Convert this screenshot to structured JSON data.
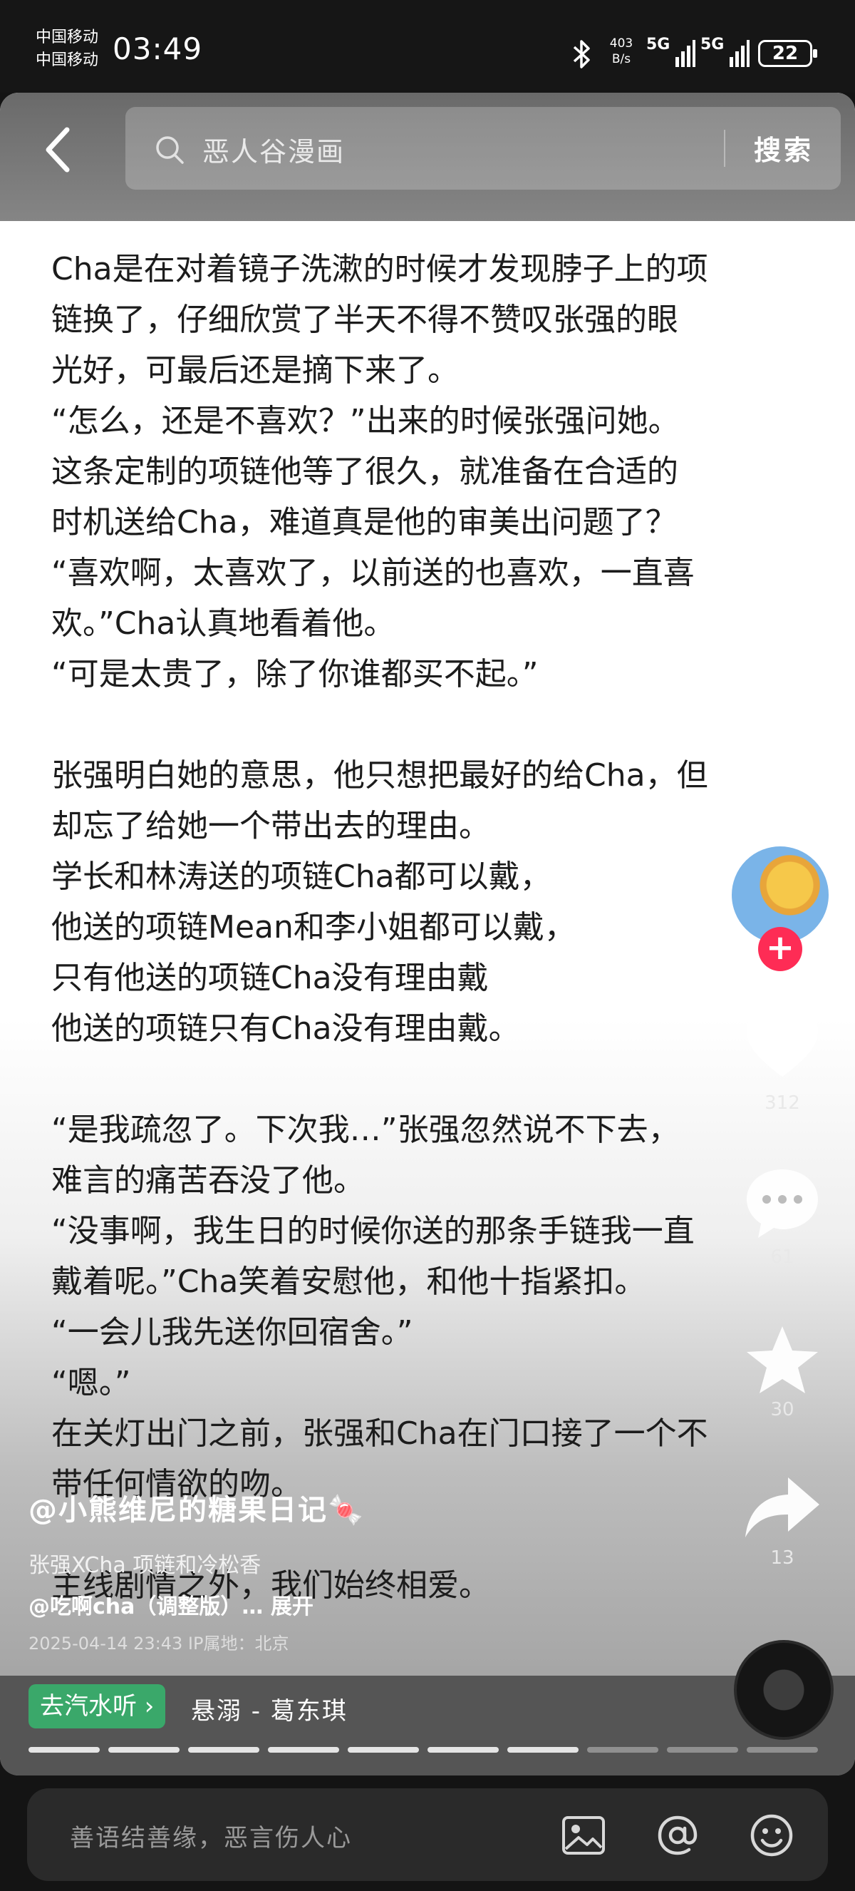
{
  "status_bar": {
    "carrier1": "中国移动",
    "carrier2": "中国移动",
    "time": "03:49",
    "net_speed_value": "403",
    "net_speed_unit": "B/s",
    "signal1": "5G",
    "signal2": "5G",
    "battery": "22"
  },
  "search": {
    "query": "恶人谷漫画",
    "button": "搜索"
  },
  "story_lines": [
    "Cha是在对着镜子洗漱的时候才发现脖子上的项",
    "链换了，仔细欣赏了半天不得不赞叹张强的眼",
    "光好，可最后还是摘下来了。",
    "“怎么，还是不喜欢？”出来的时候张强问她。",
    "这条定制的项链他等了很久，就准备在合适的",
    "时机送给Cha，难道真是他的审美出问题了？",
    "“喜欢啊，太喜欢了，以前送的也喜欢，一直喜",
    "欢。”Cha认真地看着他。",
    "“可是太贵了，除了你谁都买不起。”",
    "",
    "张强明白她的意思，他只想把最好的给Cha，但",
    "却忘了给她一个带出去的理由。",
    "学长和林涛送的项链Cha都可以戴，",
    "他送的项链Mean和李小姐都可以戴，",
    "只有他送的项链Cha没有理由戴",
    "他送的项链只有Cha没有理由戴。",
    "",
    "“是我疏忽了。下次我…”张强忽然说不下去，",
    "难言的痛苦吞没了他。",
    "“没事啊，我生日的时候你送的那条手链我一直",
    "戴着呢。”Cha笑着安慰他，和他十指紧扣。",
    "“一会儿我先送你回宿舍。”",
    "“嗯。”",
    "在关灯出门之前，张强和Cha在门口接了一个不",
    "带任何情欲的吻。",
    "",
    "主线剧情之外，我们始终相爱。"
  ],
  "actions": {
    "like_count": "312",
    "comment_count": "61",
    "favorite_count": "30",
    "share_count": "13"
  },
  "post": {
    "author": "@小熊维尼的糖果日记🍬",
    "tags": "张强XCha 项链和冷松香",
    "mention": "@吃啊cha（调整版）…  展开",
    "date": "2025-04-14 23:43 IP属地：北京"
  },
  "music": {
    "listen_label": "去汽水听 ›",
    "title": "悬溺 - 葛东琪",
    "segments_total": 10,
    "segments_done": 7
  },
  "comment_bar": {
    "placeholder": "善语结善缘，恶言伤人心"
  },
  "icons": [
    "back-arrow-icon",
    "search-icon",
    "heart-icon",
    "comment-icon",
    "star-icon",
    "share-icon",
    "image-icon",
    "at-icon",
    "emoji-icon",
    "bluetooth-icon"
  ]
}
